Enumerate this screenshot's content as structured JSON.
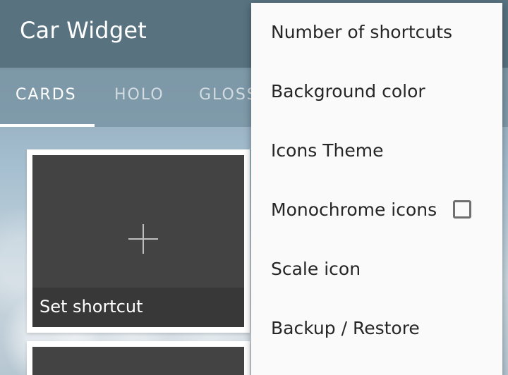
{
  "app_bar": {
    "title": "Car Widget"
  },
  "tabs": [
    {
      "label": "CARDS",
      "active": true
    },
    {
      "label": "HOLO",
      "active": false
    },
    {
      "label": "GLOSS",
      "active": false
    }
  ],
  "cards": [
    {
      "label": "Set shortcut",
      "icon": "plus-icon"
    }
  ],
  "menu": {
    "items": [
      {
        "label": "Number of shortcuts"
      },
      {
        "label": "Background color"
      },
      {
        "label": "Icons Theme"
      },
      {
        "label": "Monochrome icons",
        "checkbox": true,
        "checked": false
      },
      {
        "label": "Scale icon"
      },
      {
        "label": "Backup / Restore"
      }
    ]
  },
  "colors": {
    "app_bar": "#587280",
    "card_bg": "#434343",
    "menu_bg": "#fafafa"
  }
}
